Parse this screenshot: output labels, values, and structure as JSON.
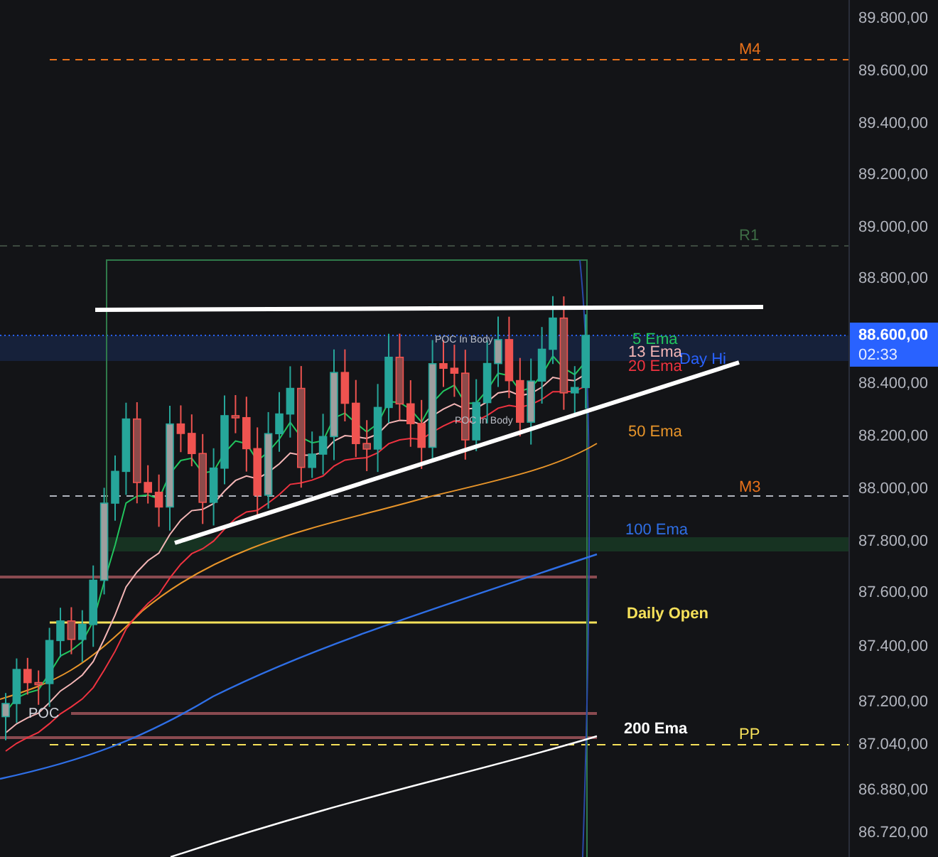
{
  "price_axis": [
    "89.800,00",
    "89.600,00",
    "89.400,00",
    "89.200,00",
    "89.000,00",
    "88.800,00",
    "88.400,00",
    "88.200,00",
    "88.000,00",
    "87.800,00",
    "87.600,00",
    "87.400,00",
    "87.200,00",
    "87.040,00",
    "86.880,00",
    "86.720,00"
  ],
  "current_price": {
    "price": "88.600,00",
    "countdown": "02:33"
  },
  "labels": [
    {
      "text": "M4",
      "color": "#e8711a"
    },
    {
      "text": "R1",
      "color": "#3d6b45"
    },
    {
      "text": "5 Ema",
      "color": "#22c55e"
    },
    {
      "text": "Day Hi",
      "color": "#2962ff"
    },
    {
      "text": "13 Ema",
      "color": "#f4b6b6"
    },
    {
      "text": "20 Ema",
      "color": "#ef3340"
    },
    {
      "text": "POC In Body",
      "color": "#b9bcc4"
    },
    {
      "text": "POC In Body",
      "color": "#b9bcc4"
    },
    {
      "text": "50 Ema",
      "color": "#e8952a"
    },
    {
      "text": "M3",
      "color": "#e8711a"
    },
    {
      "text": "100 Ema",
      "color": "#2f6fe6"
    },
    {
      "text": "Daily Open",
      "color": "#f6e15a"
    },
    {
      "text": "POC",
      "color": "#d1d4dc"
    },
    {
      "text": "200 Ema",
      "color": "#ffffff"
    },
    {
      "text": "PP",
      "color": "#f6e15a"
    }
  ]
}
